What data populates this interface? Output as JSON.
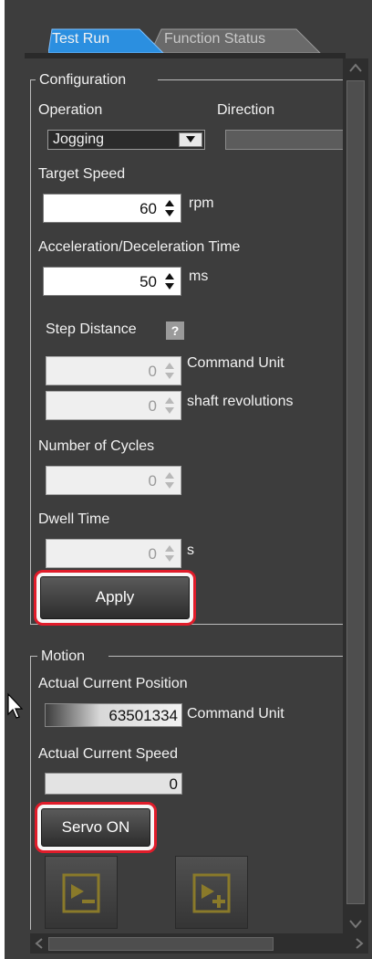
{
  "tabs": {
    "test_run": "Test Run",
    "function_status": "Function Status"
  },
  "configuration": {
    "group_label": "Configuration",
    "operation_label": "Operation",
    "direction_label": "Direction",
    "operation_value": "Jogging",
    "target_speed_label": "Target Speed",
    "target_speed_value": "60",
    "target_speed_unit": "rpm",
    "accel_label": "Acceleration/Deceleration Time",
    "accel_value": "50",
    "accel_unit": "ms",
    "step_distance_label": "Step Distance",
    "help_glyph": "?",
    "step_command_value": "0",
    "step_command_unit": "Command Unit",
    "step_shaft_value": "0",
    "step_shaft_unit": "shaft revolutions",
    "cycles_label": "Number of Cycles",
    "cycles_value": "0",
    "dwell_label": "Dwell Time",
    "dwell_value": "0",
    "dwell_unit": "s",
    "apply_label": "Apply"
  },
  "motion": {
    "group_label": "Motion",
    "position_label": "Actual Current Position",
    "position_value": "63501334",
    "position_unit": "Command Unit",
    "speed_label": "Actual Current Speed",
    "speed_value": "0",
    "servo_label": "Servo ON"
  },
  "icons": {
    "jog_reverse": "jog-reverse-icon",
    "jog_forward": "jog-forward-icon",
    "cursor": "mouse-pointer-icon"
  },
  "colors": {
    "panel": "#3d3d3d",
    "tab_active": "#2b8fe0",
    "highlight": "#e01c2a",
    "jog_icon": "#8a7a2a"
  }
}
